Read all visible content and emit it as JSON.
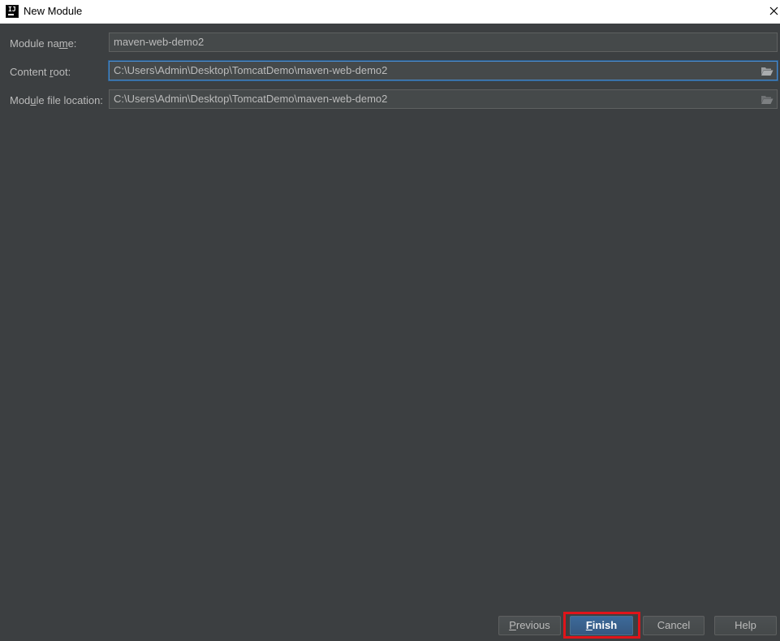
{
  "window": {
    "title": "New Module",
    "app_icon_text": "IJ"
  },
  "form": {
    "module_name": {
      "label_before": "Module na",
      "label_mnemonic": "m",
      "label_after": "e:",
      "value": "maven-web-demo2"
    },
    "content_root": {
      "label_before": "Content ",
      "label_mnemonic": "r",
      "label_after": "oot:",
      "value": "C:\\Users\\Admin\\Desktop\\TomcatDemo\\maven-web-demo2",
      "icon": "folder-open-icon"
    },
    "module_file_location": {
      "label_before": "Mod",
      "label_mnemonic": "u",
      "label_after": "le file location:",
      "value": "C:\\Users\\Admin\\Desktop\\TomcatDemo\\maven-web-demo2",
      "icon": "folder-open-icon"
    }
  },
  "buttons": {
    "previous": {
      "mnemonic": "P",
      "rest": "revious"
    },
    "finish": {
      "mnemonic": "F",
      "rest": "inish"
    },
    "cancel": {
      "label": "Cancel"
    },
    "help": {
      "label": "Help"
    }
  },
  "colors": {
    "background": "#3c3f41",
    "field_background": "#45494a",
    "focus_border": "#4a88c7",
    "default_button": "#365880",
    "highlight": "#e0141a"
  }
}
